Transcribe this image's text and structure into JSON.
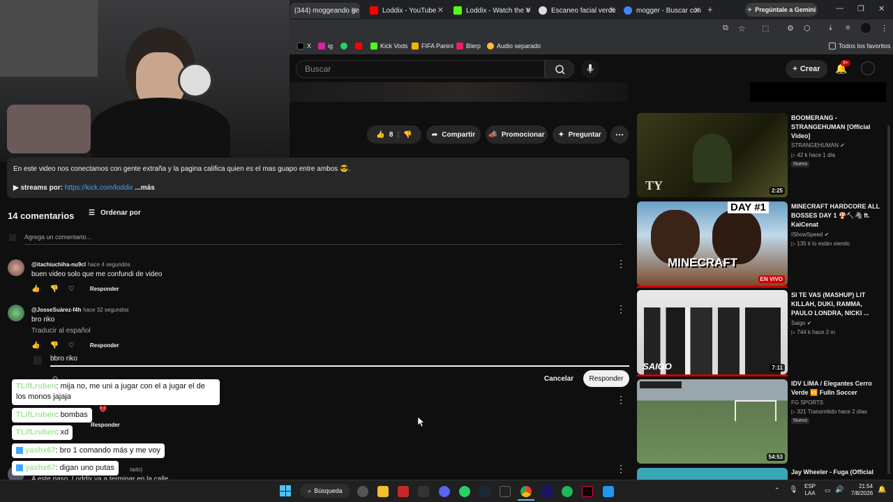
{
  "browser": {
    "tabs": [
      {
        "label": "(344) moggeando ge",
        "color": "#ff0000"
      },
      {
        "label": "Loddix - YouTube",
        "color": "#ff0000"
      },
      {
        "label": "Loddix - Watch the V",
        "color": "#53fc18"
      },
      {
        "label": "Escaneo facial verde",
        "color": "#dddddd"
      },
      {
        "label": "mogger - Buscar con",
        "color": "#4285f4"
      }
    ],
    "gemini_button": "Pregúntale a Gemini",
    "bookmarks": [
      {
        "label": "X",
        "color": "#000000"
      },
      {
        "label": "ig",
        "color": "#d6249f"
      },
      {
        "label": "",
        "color": "#25d366"
      },
      {
        "label": "",
        "color": "#ff0000"
      },
      {
        "label": "Kick Vods",
        "color": "#53fc18"
      },
      {
        "label": "FIFA Panini",
        "color": "#f4b400"
      },
      {
        "label": "Blerp",
        "color": "#e91e63"
      },
      {
        "label": "Audio separado",
        "color": "#fbc02d"
      }
    ],
    "all_bookmarks": "Todos los favoritos"
  },
  "youtube": {
    "search_placeholder": "Buscar",
    "create_label": "Crear",
    "notif_badge": "9+",
    "actions": {
      "like_count": "8",
      "share": "Compartir",
      "promote": "Promocionar",
      "ask": "Preguntar"
    },
    "description": {
      "text": "En este video nos conectamos con gente extraña y la pagina califica quien es el mas guapo entre ambos 😎.",
      "streams_prefix": "▶ streams por: ",
      "streams_link": "https://kick.com/loddix",
      "more": "...más"
    },
    "comments": {
      "count_label": "14 comentarios",
      "sort_label": "Ordenar por",
      "add_placeholder": "Agrega un comentario...",
      "items": [
        {
          "handle": "@itachiuchiha-nu9cl",
          "time": "hace 4 segundos",
          "text": "buen video solo que me confundi de video",
          "reply": "Responder"
        },
        {
          "handle": "@JosseSuárez-f4h",
          "time": "hace 32 segundos",
          "text": "bro riko",
          "translate": "Traducir al español",
          "reply": "Responder"
        }
      ],
      "reply_input_value": "bbro riko",
      "cancel": "Cancelar",
      "submit_reply": "Responder",
      "partial_reply": "Responder",
      "partial_suffix": "tado)",
      "partial_text": "A este paso, Loddix va a terminar en la calle"
    }
  },
  "chat_overlay": [
    {
      "user": "TLifLruben",
      "message": "mija no, me uni a jugar con el a jugar el de los monos jajaja"
    },
    {
      "user": "TLifLruben",
      "message": "bombas"
    },
    {
      "user": "TLifLruben",
      "message": "xd"
    },
    {
      "user": "yashx67",
      "message": "bro 1 comando más y me voy"
    },
    {
      "user": "yashx67",
      "message": "digan uno putas"
    }
  ],
  "sidebar": [
    {
      "title": "BOOMERANG - STRANGEHUMAN [Official Video]",
      "channel": "STRANGEHUMAN",
      "meta": "▷ 42 k   hace 1 día",
      "badge": "Nuevo",
      "duration": "2:25"
    },
    {
      "title": "MINECRAFT HARDCORE ALL BOSSES DAY 1 🍄🔨🦓 ft. KaiCenat",
      "channel": "IShowSpeed",
      "meta": "▷ 135 k lo están viendo",
      "badge": "",
      "duration": "EN VIVO",
      "thumb_text": "DAY #1",
      "thumb_text2": "MINECRAFT"
    },
    {
      "title": "SI TE VAS (MASHUP) LIT KILLAH, DUKI, RAMMA, PAULO LONDRA, NICKI ...",
      "channel": "Saigo",
      "meta": "▷ 744 k   hace 2 m",
      "badge": "",
      "duration": "7:11",
      "thumb_text": "SAIGO"
    },
    {
      "title": "IDV LIMA / Elegantes Cerro Verde 🆚 FuIln Soccer",
      "channel": "FG SPORTS",
      "meta": "▷ 321  Transmitido hace 2 días",
      "badge": "Nuevo",
      "duration": "54:53"
    },
    {
      "title": "Jay Wheeler - Fuga (Official",
      "channel": "",
      "meta": "",
      "badge": "",
      "duration": ""
    }
  ],
  "taskbar": {
    "search_label": "Búsqueda",
    "lang": "ESP",
    "lang2": "LAA",
    "time": "21:54",
    "date": "7/8/2026"
  }
}
